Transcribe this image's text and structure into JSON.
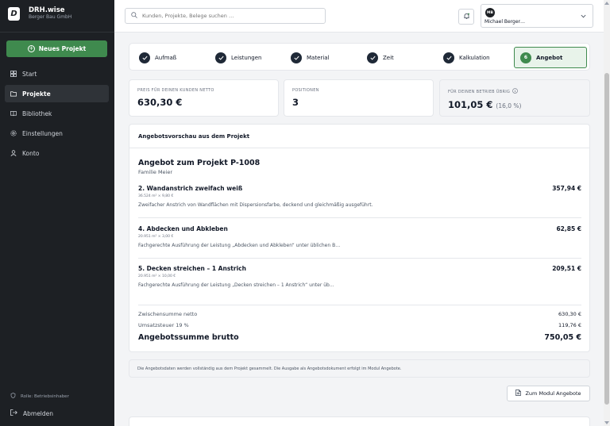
{
  "brand": {
    "logo": "D",
    "name": "DRH.wise",
    "company": "Berger Bau GmbH"
  },
  "sidebar": {
    "new_project_label": "Neues Projekt",
    "items": [
      {
        "label": "Start",
        "icon": "grid-icon"
      },
      {
        "label": "Projekte",
        "icon": "folder-icon",
        "active": true
      },
      {
        "label": "Bibliothek",
        "icon": "book-icon"
      },
      {
        "label": "Einstellungen",
        "icon": "gear-icon"
      },
      {
        "label": "Konto",
        "icon": "user-icon"
      }
    ],
    "role_label": "Rolle: Betriebsinhaber",
    "logout_label": "Abmelden"
  },
  "header": {
    "search_placeholder": "Kunden, Projekte, Belege suchen …",
    "user_initials": "MB",
    "user_name": "Michael Berger…"
  },
  "steps": [
    {
      "label": "Aufmaß",
      "done": true
    },
    {
      "label": "Leistungen",
      "done": true
    },
    {
      "label": "Material",
      "done": true
    },
    {
      "label": "Zeit",
      "done": true
    },
    {
      "label": "Kalkulation",
      "done": true
    },
    {
      "label": "Angebot",
      "number": "6",
      "active": true
    }
  ],
  "summary": {
    "price_label": "PREIS FÜR DEINEN KUNDEN NETTO",
    "price_value": "630,30 €",
    "positions_label": "POSITIONEN",
    "positions_value": "3",
    "remaining_label": "FÜR DEINEN BETRIEB ÜBRIG",
    "remaining_value": "101,05 €",
    "remaining_pct": "(16,0 %)"
  },
  "preview": {
    "heading": "Angebotsvorschau aus dem Projekt",
    "offer_title": "Angebot zum Projekt P-1008",
    "client": "Familie Meier",
    "items": [
      {
        "title": "2. Wandanstrich zweifach weiß",
        "calc": "36.524 m² × 9,80 €",
        "desc": "Zweifacher Anstrich von Wandflächen mit Dispersionsfarbe, deckend und gleichmäßig ausgeführt.",
        "price": "357,94 €"
      },
      {
        "title": "4. Abdecken und Abkleben",
        "calc": "20.951 m² × 3,00 €",
        "desc": "Fachgerechte Ausführung der Leistung „Abdecken und Abkleben“ unter üblichen B…",
        "price": "62,85 €"
      },
      {
        "title": "5. Decken streichen – 1 Anstrich",
        "calc": "20.951 m² × 10,00 €",
        "desc": "Fachgerechte Ausführung der Leistung „Decken streichen – 1 Anstrich“ unter üb…",
        "price": "209,51 €"
      }
    ],
    "subtotal_label": "Zwischensumme netto",
    "subtotal_value": "630,30 €",
    "vat_label": "Umsatzsteuer 19 %",
    "vat_value": "119,76 €",
    "total_label": "Angebotssumme brutto",
    "total_value": "750,05 €"
  },
  "info_text": "Die Angebotsdaten werden vollständig aus dem Projekt gesammelt. Die Ausgabe als Angebotsdokument erfolgt im Modul Angebote.",
  "modul_button_label": "Zum Modul Angebote",
  "colors": {
    "sidebar": "#1d2024",
    "accent": "#3f8a4e",
    "active_step_bg": "#e8f3ea"
  }
}
